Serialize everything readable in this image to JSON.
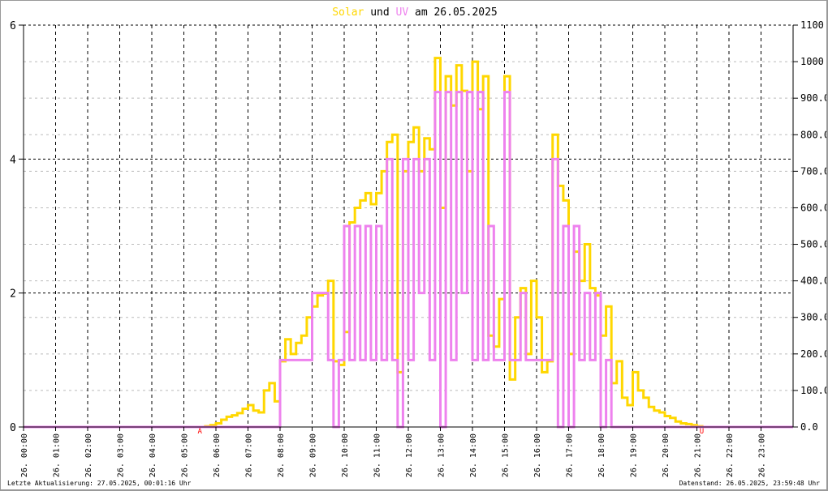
{
  "chart_data": {
    "type": "line",
    "title": {
      "part1": "Solar",
      "part2": "und",
      "part3": "UV",
      "part4": "am 26.05.2025"
    },
    "colors": {
      "solar": "#FFD700",
      "uv": "#EE82EE",
      "marker": "#FF0000"
    },
    "x_unit": "hour",
    "x_range": [
      0,
      24
    ],
    "x_tick_labels": [
      "26. 00:00",
      "26. 01:00",
      "26. 02:00",
      "26. 03:00",
      "26. 04:00",
      "26. 05:00",
      "26. 06:00",
      "26. 07:00",
      "26. 08:00",
      "26. 09:00",
      "26. 10:00",
      "26. 11:00",
      "26. 12:00",
      "26. 13:00",
      "26. 14:00",
      "26. 15:00",
      "26. 16:00",
      "26. 17:00",
      "26. 18:00",
      "26. 19:00",
      "26. 20:00",
      "26. 21:00",
      "26. 22:00",
      "26. 23:00"
    ],
    "y_left": {
      "range": [
        0,
        6
      ],
      "ticks": [
        "0",
        "2",
        "4",
        "6"
      ],
      "tick_values": [
        0,
        2,
        4,
        6
      ]
    },
    "y_right": {
      "range": [
        0,
        1100
      ],
      "ticks": [
        "0.0",
        "100.0",
        "200.0",
        "300.0",
        "400.0",
        "500.0",
        "600.0",
        "700.0",
        "800.0",
        "900.0",
        "1000",
        "1100"
      ],
      "tick_values": [
        0,
        100,
        200,
        300,
        400,
        500,
        600,
        700,
        800,
        900,
        1000,
        1100
      ]
    },
    "grid": true,
    "series": [
      {
        "name": "Solar",
        "axis": "right",
        "start_hour": 5.5,
        "step_minutes": 10,
        "values": [
          0,
          2,
          5,
          10,
          20,
          28,
          32,
          38,
          50,
          60,
          45,
          40,
          100,
          120,
          70,
          180,
          240,
          200,
          230,
          250,
          300,
          330,
          360,
          365,
          400,
          180,
          170,
          260,
          560,
          600,
          620,
          640,
          610,
          640,
          700,
          780,
          800,
          150,
          700,
          780,
          820,
          700,
          790,
          760,
          1010,
          600,
          960,
          880,
          990,
          920,
          700,
          1000,
          870,
          960,
          250,
          220,
          350,
          960,
          130,
          300,
          380,
          200,
          400,
          300,
          150,
          180,
          800,
          660,
          620,
          200,
          480,
          400,
          500,
          380,
          360,
          250,
          330,
          120,
          180,
          80,
          60,
          150,
          100,
          80,
          55,
          45,
          40,
          30,
          25,
          15,
          10,
          8,
          5,
          2,
          0
        ]
      },
      {
        "name": "UV",
        "axis": "left",
        "start_hour": 7.8333,
        "step_minutes": 10,
        "values": [
          0,
          1,
          1,
          1,
          1,
          1,
          1,
          2,
          2,
          2,
          1,
          0,
          1,
          3,
          1,
          3,
          1,
          3,
          1,
          3,
          1,
          4,
          1,
          0,
          4,
          1,
          4,
          2,
          4,
          1,
          5,
          0,
          5,
          1,
          5,
          2,
          5,
          1,
          5,
          1,
          3,
          1,
          1,
          5,
          1,
          1,
          2,
          1,
          1,
          1,
          1,
          1,
          4,
          0,
          3,
          0,
          3,
          1,
          2,
          1,
          2,
          0,
          1,
          0,
          0
        ]
      }
    ],
    "annotations": [
      {
        "label": "A",
        "hour": 5.5
      },
      {
        "label": "U",
        "hour": 21.15
      }
    ]
  },
  "footer": {
    "left": "Letzte Aktualisierung: 27.05.2025, 00:01:16 Uhr",
    "right": "Datenstand: 26.05.2025, 23:59:48 Uhr"
  }
}
